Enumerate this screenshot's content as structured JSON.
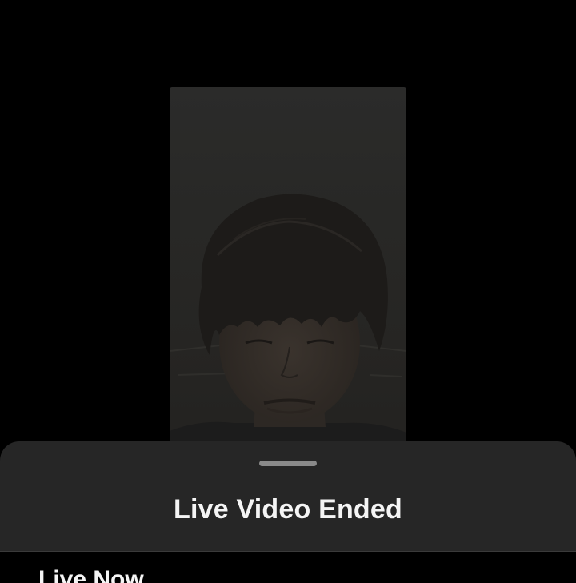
{
  "video": {
    "status": "ended"
  },
  "sheet": {
    "title": "Live Video Ended",
    "section_header": "Live Now"
  },
  "colors": {
    "background": "#000000",
    "sheet_background": "#262626",
    "text": "#f5f5f5",
    "handle": "#8a8a8a"
  }
}
